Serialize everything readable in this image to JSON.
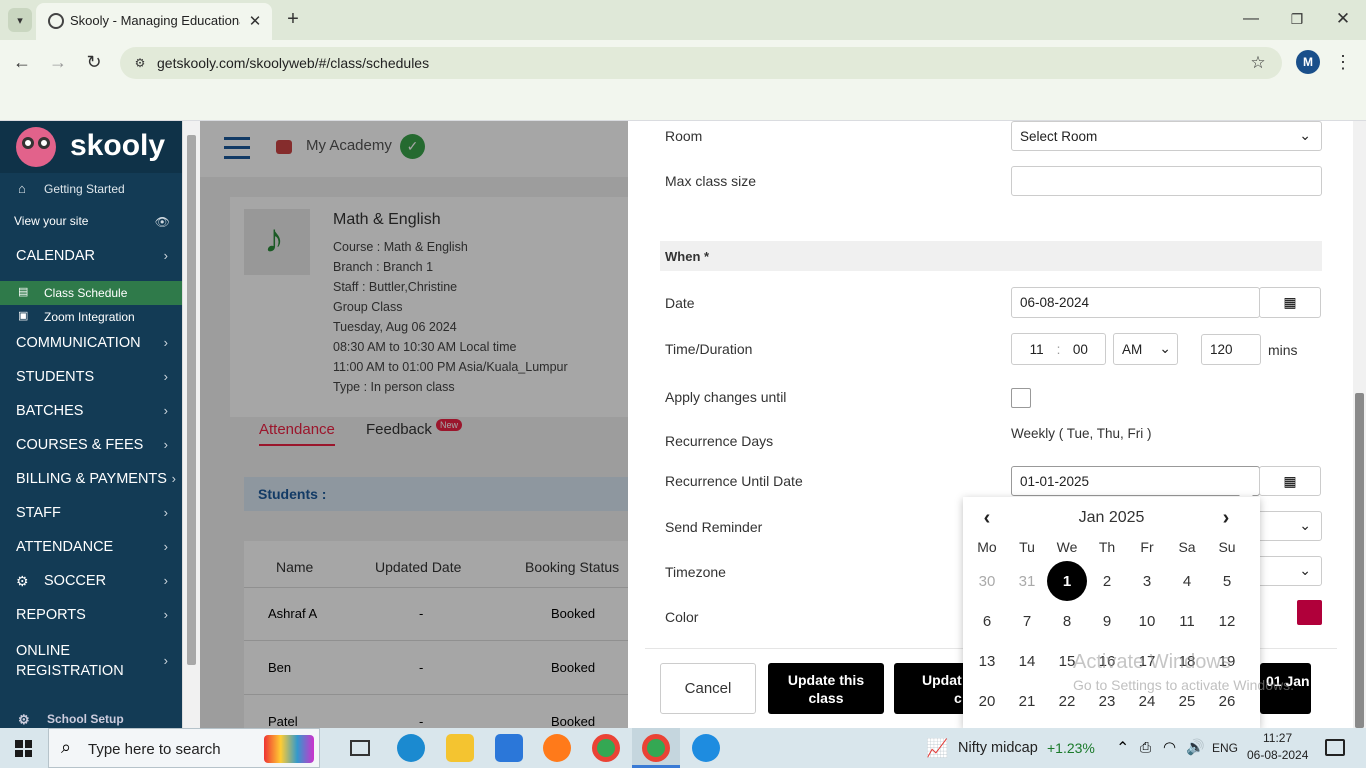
{
  "browser": {
    "tab_title": "Skooly - Managing Educational",
    "url": "getskooly.com/skoolyweb/#/class/schedules",
    "profile_initial": "M"
  },
  "sidebar": {
    "brand": "skooly",
    "items": [
      {
        "label": "Getting Started"
      },
      {
        "label": "View your site"
      },
      {
        "label": "CALENDAR"
      },
      {
        "label": "Class Schedule"
      },
      {
        "label": "Zoom Integration"
      },
      {
        "label": "COMMUNICATION"
      },
      {
        "label": "STUDENTS"
      },
      {
        "label": "BATCHES"
      },
      {
        "label": "COURSES & FEES"
      },
      {
        "label": "BILLING & PAYMENTS"
      },
      {
        "label": "STAFF"
      },
      {
        "label": "ATTENDANCE"
      },
      {
        "label": "SOCCER"
      },
      {
        "label": "REPORTS"
      },
      {
        "label": "ONLINE"
      },
      {
        "label": "REGISTRATION"
      },
      {
        "label": "School Setup"
      }
    ]
  },
  "header": {
    "academy": "My Academy"
  },
  "class_info": {
    "title": "Math & English",
    "lines": [
      "Course : Math & English",
      "Branch : Branch 1",
      "Staff : Buttler,Christine",
      "Group Class",
      "Tuesday, Aug 06 2024",
      "08:30 AM to 10:30 AM Local time",
      "11:00 AM to 01:00 PM Asia/Kuala_Lumpur",
      "Type : In person class"
    ]
  },
  "tabs": {
    "attendance": "Attendance",
    "feedback": "Feedback",
    "new_badge": "New"
  },
  "students": {
    "heading": "Students :",
    "columns": [
      "Name",
      "Updated Date",
      "Booking Status"
    ],
    "rows": [
      [
        "Ashraf A",
        "-",
        "Booked"
      ],
      [
        "Ben",
        "-",
        "Booked"
      ],
      [
        "Patel",
        "-",
        "Booked"
      ]
    ]
  },
  "form": {
    "room_label": "Room",
    "room_value": "Select Room",
    "max_size_label": "Max class size",
    "max_size_value": "",
    "when_label": "When *",
    "date_label": "Date",
    "date_value": "06-08-2024",
    "time_label": "Time/Duration",
    "hour": "11",
    "colon": ":",
    "minute": "00",
    "ampm": "AM",
    "duration": "120",
    "mins": "mins",
    "apply_label": "Apply changes until",
    "rec_days_label": "Recurrence Days",
    "rec_days_value": "Weekly ( Tue, Thu, Fri )",
    "rec_until_label": "Recurrence Until Date",
    "rec_until_value": "01-01-2025",
    "reminder_label": "Send Reminder",
    "timezone_label": "Timezone",
    "color_label": "Color",
    "color_value": "#b0003a",
    "cancel": "Cancel",
    "update_this": "Update this class",
    "update_following_partial": "Updat",
    "update_following_partial2": "c",
    "update_until_partial": "01 Jan"
  },
  "datepicker": {
    "month": "Jan 2025",
    "weekdays": [
      "Mo",
      "Tu",
      "We",
      "Th",
      "Fr",
      "Sa",
      "Su"
    ],
    "weeks": [
      [
        "30",
        "31",
        "1",
        "2",
        "3",
        "4",
        "5"
      ],
      [
        "6",
        "7",
        "8",
        "9",
        "10",
        "11",
        "12"
      ],
      [
        "13",
        "14",
        "15",
        "16",
        "17",
        "18",
        "19"
      ],
      [
        "20",
        "21",
        "22",
        "23",
        "24",
        "25",
        "26"
      ]
    ],
    "selected": "1"
  },
  "watermark": {
    "line1": "Activate Windows",
    "line2": "Go to Settings to activate Windows."
  },
  "taskbar": {
    "search_placeholder": "Type here to search",
    "stock_name": "Nifty midcap",
    "stock_change": "+1.23%",
    "lang": "ENG",
    "time": "11:27",
    "date": "06-08-2024"
  }
}
